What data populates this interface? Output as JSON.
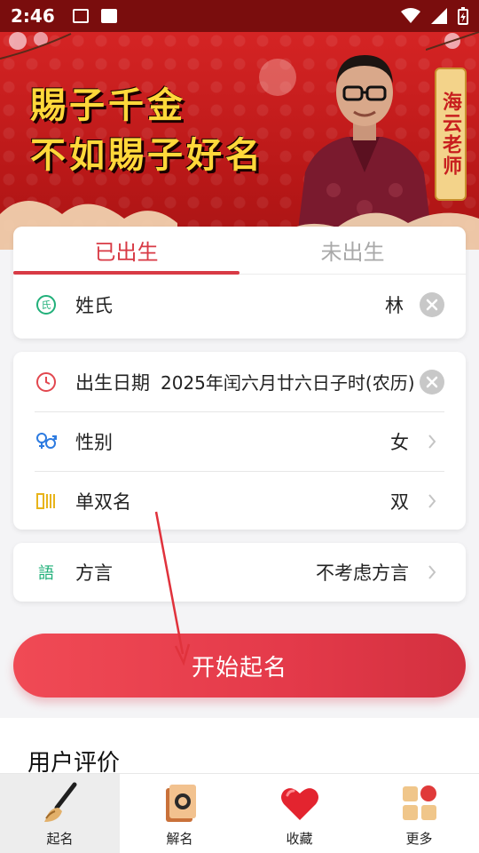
{
  "status_bar": {
    "time": "2:46"
  },
  "banner": {
    "slogan_line1": "賜子千金",
    "slogan_line2": "不如賜子好名",
    "teacher_name": "海云老师"
  },
  "tabs": [
    {
      "label": "已出生",
      "active": true
    },
    {
      "label": "未出生",
      "active": false
    }
  ],
  "surname": {
    "icon": "surname-icon",
    "label": "姓氏",
    "value": "林"
  },
  "birth": {
    "icon": "clock-icon",
    "label": "出生日期",
    "value": "2025年闰六月廿六日子时(农历)"
  },
  "gender": {
    "icon": "gender-icon",
    "label": "性别",
    "value": "女"
  },
  "name_length": {
    "icon": "single-double-name-icon",
    "label": "单双名",
    "value": "双"
  },
  "dialect": {
    "icon": "dialect-icon",
    "label": "方言",
    "value": "不考虑方言"
  },
  "start_button": "开始起名",
  "reviews_title": "用户评价",
  "nav": [
    {
      "label": "起名",
      "icon": "brush-icon",
      "active": true
    },
    {
      "label": "解名",
      "icon": "scroll-icon",
      "active": false
    },
    {
      "label": "收藏",
      "icon": "heart-icon",
      "active": false
    },
    {
      "label": "更多",
      "icon": "more-grid-icon",
      "active": false
    }
  ],
  "colors": {
    "accent": "#d83a45",
    "banner": "#c51d1d",
    "slogan": "#ffd83a"
  }
}
